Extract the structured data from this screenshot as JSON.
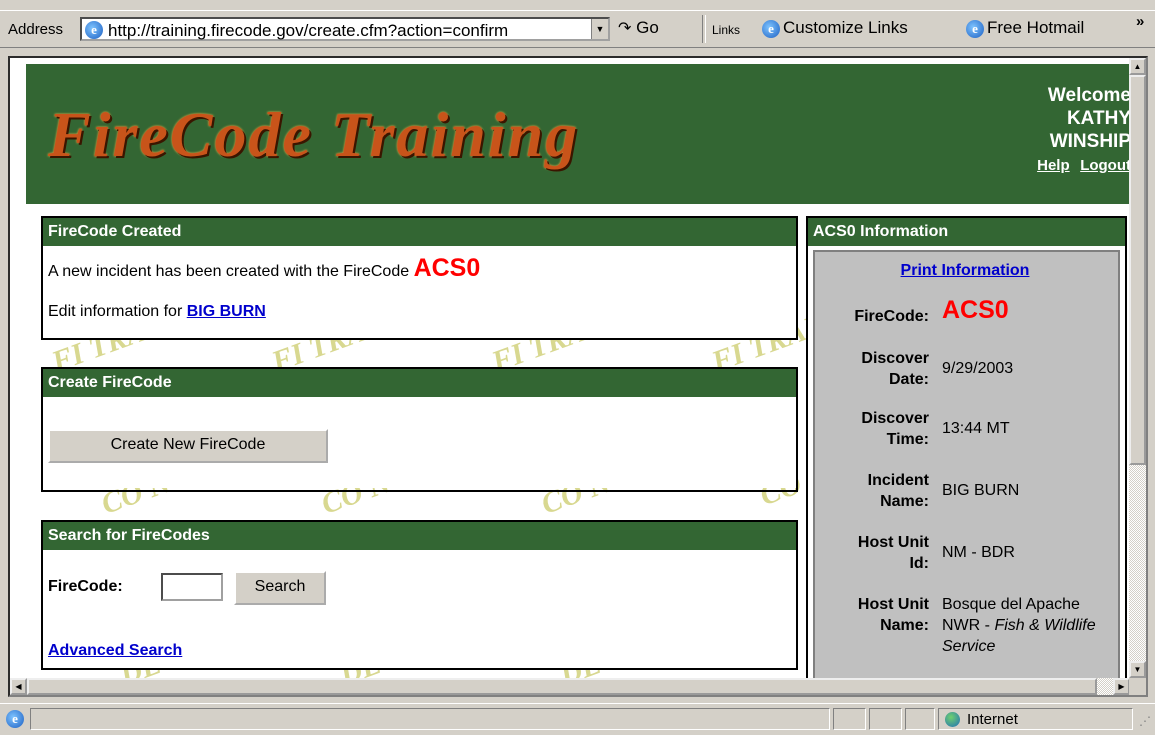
{
  "toolbar": {
    "address_label": "Address",
    "url": "http://training.firecode.gov/create.cfm?action=confirm",
    "go_label": "Go",
    "links_label": "Links",
    "link_items": [
      "Customize Links",
      "Free Hotmail"
    ],
    "chevron": "»"
  },
  "header": {
    "logo_text": "FireCode Training",
    "welcome": "Welcome",
    "user_first": "KATHY",
    "user_last": "WINSHIP",
    "help": "Help",
    "logout": "Logout"
  },
  "created": {
    "title": "FireCode Created",
    "message": "A new incident has been created with the FireCode",
    "code": "ACS0",
    "edit_prefix": "Edit information for",
    "incident_link": "BIG BURN"
  },
  "create": {
    "title": "Create FireCode",
    "button": "Create New FireCode"
  },
  "search": {
    "title": "Search for FireCodes",
    "label": "FireCode:",
    "input_value": "",
    "button": "Search",
    "advanced": "Advanced Search"
  },
  "info": {
    "title": "ACS0 Information",
    "print": "Print Information",
    "rows": [
      {
        "k1": "",
        "k2": "FireCode:",
        "v": "ACS0"
      },
      {
        "k1": "Discover",
        "k2": "Date:",
        "v": "9/29/2003"
      },
      {
        "k1": "Discover",
        "k2": "Time:",
        "v": "13:44 MT"
      },
      {
        "k1": "Incident",
        "k2": "Name:",
        "v": "BIG BURN"
      },
      {
        "k1": "Host Unit",
        "k2": "Id:",
        "v": "NM - BDR"
      },
      {
        "k1": "Host Unit",
        "k2": "Name:",
        "v": "Bosque del Apache NWR - ",
        "v_it": "Fish & Wildlife Service"
      }
    ]
  },
  "status": {
    "zone": "Internet"
  },
  "colors": {
    "header_green": "#336633",
    "firecode_red": "#ff0000",
    "link_blue": "#0000cc"
  }
}
